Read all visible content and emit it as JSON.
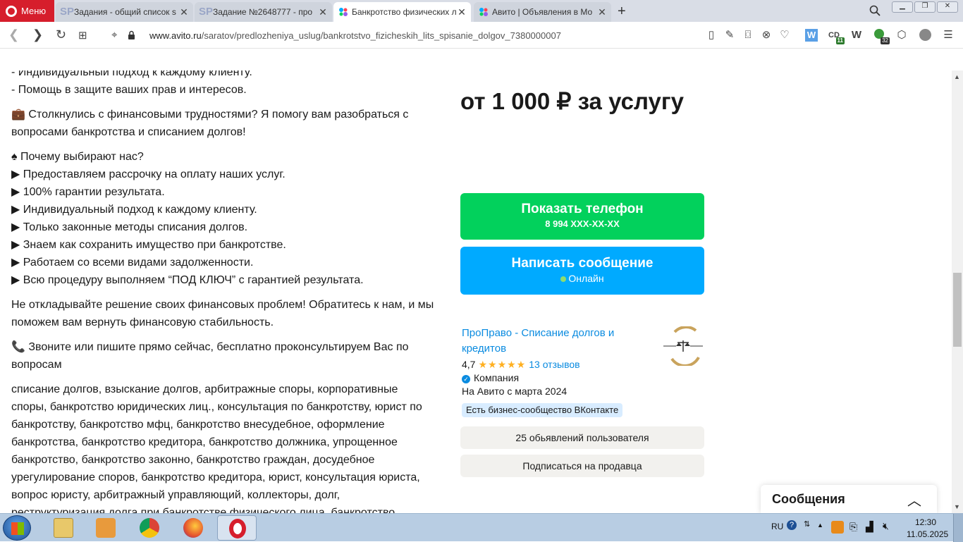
{
  "browser": {
    "menu_label": "Меню",
    "tabs": [
      {
        "title": "Задания - общий список s",
        "favicon": "SP"
      },
      {
        "title": "Задание №2648777 - про",
        "favicon": "SP"
      },
      {
        "title": "Банкротство физических л",
        "favicon": "avito"
      },
      {
        "title": "Авито | Объявления в Мо",
        "favicon": "avito"
      }
    ],
    "new_tab": "+",
    "url_host": "www.avito.ru",
    "url_path": "/saratov/predlozheniya_uslug/bankrotstvo_fizicheskih_lits_spisanie_dolgov_7380000007",
    "ext_badges": {
      "cd": "11",
      "green": "32"
    }
  },
  "listing": {
    "description": [
      "- Индивидуальный подход к каждому клиенту.",
      "- Помощь в защите ваших прав и интересов.",
      "💼 Столкнулись с финансовыми трудностями? Я помогу вам разобраться с вопросами банкротства и списанием долгов!",
      "♠ Почему выбирают нас?",
      "▶ Предоставляем рассрочку на оплату наших услуг.",
      "▶ 100% гарантии результата.",
      "▶ Индивидуальный подход к каждому клиенту.",
      "▶ Только законные методы списания долгов.",
      "▶ Знаем как сохранить имущество при банкротстве.",
      "▶ Работаем со всеми видами задолженности.",
      "▶ Всю процедуру выполняем “ПОД КЛЮЧ” с гарантией результата.",
      "Не откладывайте решение своих финансовых проблем! Обратитесь к нам, и мы поможем вам вернуть финансовую стабильность.",
      "📞 Звоните или пишите прямо сейчас, бесплатно проконсультируем Вас по вопросам",
      "списание долгов, взыскание долгов, арбитражные споры, корпоративные споры, банкротство юридических лиц., консультация по банкротству, юрист по банкротству, банкротство мфц, банкротство внесудебное, оформление банкротства, банкротство кредитора, банкротство должника, упрощенное банкротство, банкротство законно, банкротство граждан, досудебное урегулирование споров, банкротство кредитора, юрист, консультация юриста, вопрос юристу, арбитражный управляющий, коллекторы, долг, реструктуризация долга при банкротстве физического лица, банкротство"
    ],
    "price": "от 1 000 ₽ за услугу",
    "show_phone_label": "Показать телефон",
    "phone_masked": "8 994 XXX-XX-XX",
    "write_message_label": "Написать сообщение",
    "online_label": "Онлайн",
    "seller": {
      "name": "ПроПраво - Списание долгов и кредитов",
      "rating": "4,7",
      "stars": "★★★★★",
      "reviews": "13 отзывов",
      "type": "Компания",
      "since": "На Авито с марта 2024",
      "badge": "Есть бизнес-сообщество ВКонтакте"
    },
    "ads_count_label": "25 обьявлений пользователя",
    "subscribe_label": "Подписаться на продавца",
    "messages_panel": "Сообщения"
  },
  "taskbar": {
    "lang": "RU",
    "time": "12:30",
    "date": "11.05.2025"
  },
  "colors": {
    "green_button": "#02d15c",
    "blue_button": "#00aaff",
    "link": "#0a8be0",
    "opera_red": "#d61e2c"
  }
}
